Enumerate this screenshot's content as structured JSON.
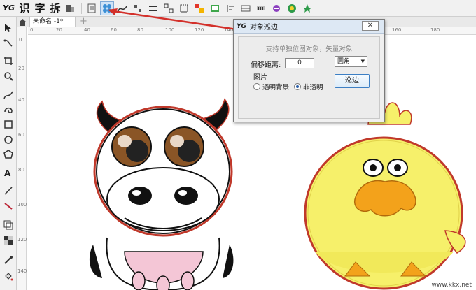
{
  "toolbar": {
    "logo": "YG",
    "chars": [
      "识",
      "字",
      "拆"
    ]
  },
  "tabs": {
    "document": "未命名 -1*",
    "add": "+"
  },
  "rulers": {
    "top": [
      "0",
      "20",
      "40",
      "60",
      "80",
      "100",
      "120",
      "140",
      "160",
      "180"
    ],
    "left": [
      "0",
      "20",
      "40",
      "60",
      "80",
      "100",
      "120",
      "140"
    ]
  },
  "dialog": {
    "logo": "YG",
    "title": "对象巡边",
    "close": "✕",
    "hint": "支持单独位图对象，矢量对象",
    "offset_label": "偏移距离:",
    "offset_value": "0",
    "corner_select": "圆角",
    "image_label": "图片",
    "radio_transparent": "透明背景",
    "radio_opaque": "非透明",
    "selected_radio": "非透明",
    "apply_button": "巡边"
  },
  "watermark": "www.kkx.net",
  "colors": {
    "accent": "#3c7fc4",
    "outline": "#c0392b",
    "duck": "#f6f06a",
    "beak": "#f3a21b",
    "cow_brown": "#8a5526",
    "udder": "#f4c6d6"
  }
}
